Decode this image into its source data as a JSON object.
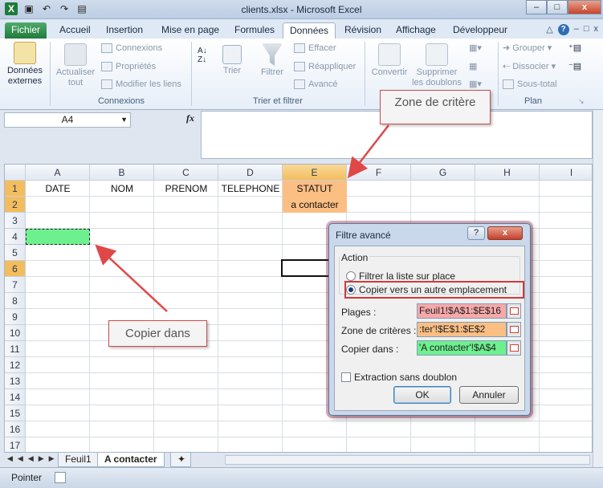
{
  "window": {
    "title": "clients.xlsx - Microsoft Excel"
  },
  "tabs": [
    "Fichier",
    "Accueil",
    "Insertion",
    "Mise en page",
    "Formules",
    "Données",
    "Révision",
    "Affichage",
    "Développeur"
  ],
  "ribbon": {
    "donnees_externes": "Données externes",
    "actualiser": "Actualiser tout",
    "connexions": "Connexions",
    "proprietes": "Propriétés",
    "modifier_liens": "Modifier les liens",
    "group_connexions": "Connexions",
    "trier": "Trier",
    "filtrer": "Filtrer",
    "effacer": "Effacer",
    "reappliquer": "Réappliquer",
    "avance": "Avancé",
    "group_trier": "Trier et filtrer",
    "convertir": "Convertir",
    "supprimer_doublons": "Supprimer les doublons",
    "grouper": "Grouper",
    "dissocier": "Dissocier",
    "sous_total": "Sous-total",
    "group_plan": "Plan"
  },
  "formula_bar": {
    "name_box": "A4",
    "fx": "fx",
    "formula": ""
  },
  "grid": {
    "columns": [
      "A",
      "B",
      "C",
      "D",
      "E",
      "F",
      "G",
      "H",
      "I"
    ],
    "rows": [
      "1",
      "2",
      "3",
      "4",
      "5",
      "6",
      "7",
      "8",
      "9",
      "10",
      "11",
      "12",
      "13",
      "14",
      "15",
      "16",
      "17"
    ],
    "headers": {
      "A1": "DATE",
      "B1": "NOM",
      "C1": "PRENOM",
      "D1": "TELEPHONE",
      "E1": "STATUT",
      "E2": "a contacter"
    }
  },
  "callouts": {
    "zone_critere": "Zone de critère",
    "copier_dans": "Copier dans"
  },
  "dialog": {
    "title": "Filtre avancé",
    "help": "?",
    "close": "x",
    "action_label": "Action",
    "radio_filter": "Filtrer la liste sur place",
    "radio_copy": "Copier vers un autre emplacement",
    "plages_label": "Plages :",
    "plages_value": "Feuil1!$A$1:$E$16",
    "zone_label": "Zone de critères :",
    "zone_value": ":ter'!$E$1:$E$2",
    "copier_label": "Copier dans :",
    "copier_value": "'A contacter'!$A$4",
    "extraction": "Extraction sans doublon",
    "ok": "OK",
    "annuler": "Annuler",
    "colors": {
      "plages": "#f7a9a9",
      "zone": "#fbbf84",
      "copier": "#6ef08f"
    }
  },
  "sheets": [
    "Feuil1",
    "A contacter"
  ],
  "status": {
    "mode": "Pointer"
  }
}
